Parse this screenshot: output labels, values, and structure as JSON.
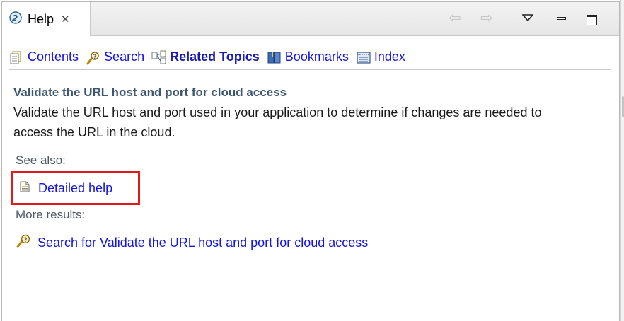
{
  "tab": {
    "title": "Help",
    "icon": "help-icon",
    "close_icon": "close-icon"
  },
  "toolbar": {
    "contents": "Contents",
    "search": "Search",
    "related_topics": "Related Topics",
    "bookmarks": "Bookmarks",
    "index": "Index"
  },
  "main": {
    "title": "Validate the URL host and port for cloud access",
    "description": "Validate the URL host and port used in your application to determine if changes are needed to access the URL in the cloud.",
    "see_also_label": "See also:",
    "detailed_help": "Detailed help",
    "more_results_label": "More results:",
    "search_result": "Search for Validate the URL host and port for cloud access"
  },
  "colors": {
    "link": "#1515d8",
    "heading": "#3d5670",
    "highlight": "#e11b1b"
  }
}
